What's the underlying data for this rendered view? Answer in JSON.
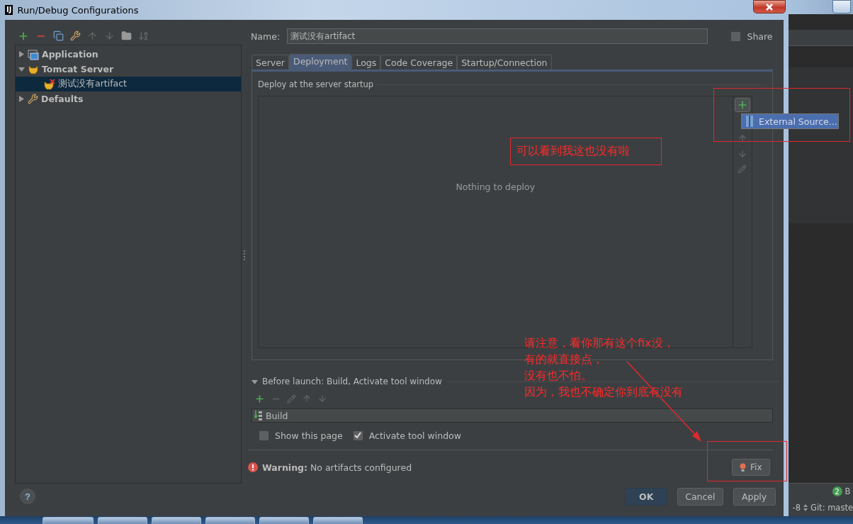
{
  "window": {
    "logo": "IJ",
    "title": "Run/Debug Configurations"
  },
  "tree": [
    {
      "label": "Application",
      "expanded": false,
      "selected": false
    },
    {
      "label": "Tomcat Server",
      "expanded": true,
      "selected": false,
      "children": [
        {
          "label": "测试没有artifact",
          "selected": true
        }
      ]
    },
    {
      "label": "Defaults",
      "expanded": false,
      "selected": false
    }
  ],
  "name_field": {
    "label": "Name:",
    "value": "测试没有artifact"
  },
  "share": {
    "label": "Share",
    "checked": false
  },
  "tabs": [
    {
      "label": "Server",
      "selected": false
    },
    {
      "label": "Deployment",
      "selected": true
    },
    {
      "label": "Logs",
      "selected": false
    },
    {
      "label": "Code Coverage",
      "selected": false
    },
    {
      "label": "Startup/Connection",
      "selected": false
    }
  ],
  "deployment": {
    "section_title": "Deploy at the server startup",
    "empty_text": "Nothing to deploy",
    "popup_menu": [
      {
        "label": "External Source..."
      }
    ]
  },
  "before_launch": {
    "title": "Before launch: Build, Activate tool window",
    "expanded": true,
    "tasks": [
      {
        "label": "Build"
      }
    ],
    "checkboxes": [
      {
        "label": "Show this page",
        "checked": false
      },
      {
        "label": "Activate tool window",
        "checked": true
      }
    ]
  },
  "warning": "**Warning:** No artifacts configured",
  "fix_button": "Fix",
  "help": "?",
  "buttons": [
    {
      "label": "OK",
      "kind": "default"
    },
    {
      "label": "Cancel",
      "kind": "normal"
    },
    {
      "label": "Apply",
      "kind": "normal"
    }
  ],
  "background_ide": {
    "badge": "2",
    "badge_label": "B",
    "encoding": "-8",
    "git": "Git: maste"
  },
  "annotations": [
    {
      "kind": "boxed",
      "text": "可以看到我这也没有啦"
    },
    {
      "kind": "note",
      "lines": [
        "请注意，看你那有这个fix没，",
        "有的就直接点，",
        "没有也不怕。",
        "因为，我也不确定你到底有没有"
      ]
    }
  ]
}
